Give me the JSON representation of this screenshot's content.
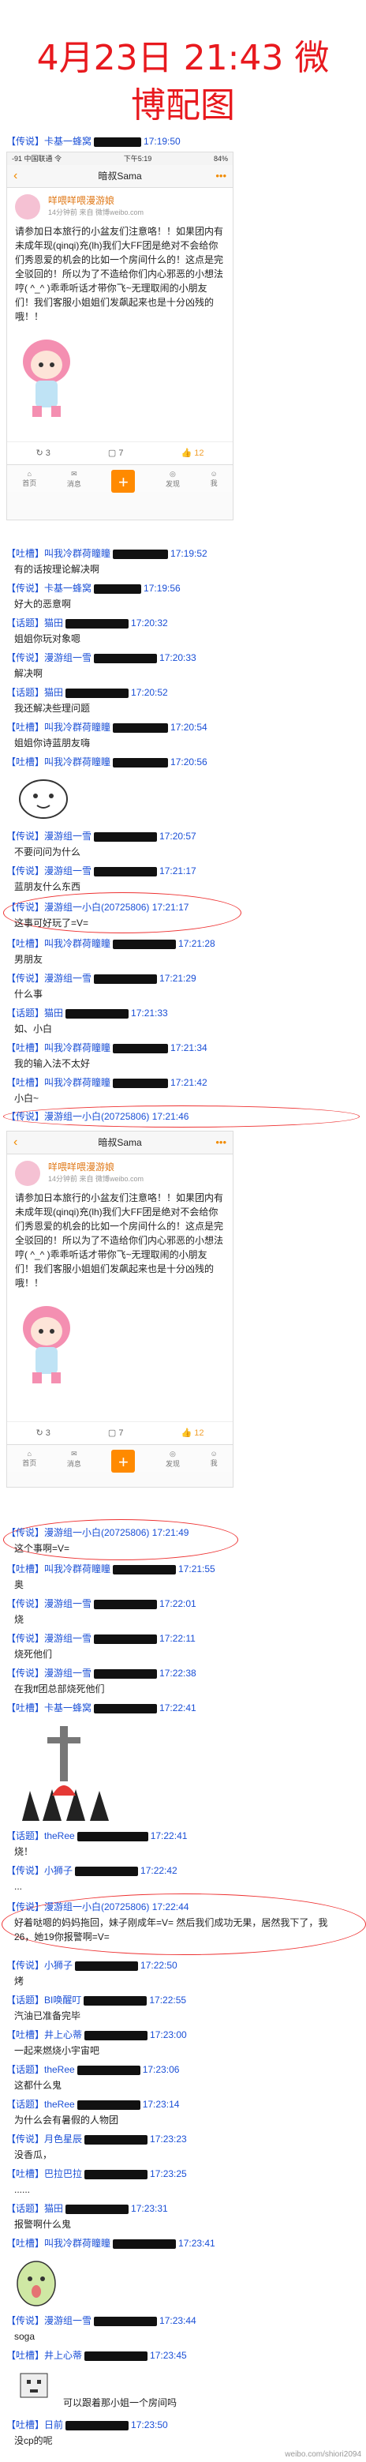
{
  "header": {
    "title_line1": "4月23日 21:43 微",
    "title_line2": "博配图"
  },
  "phone1": {
    "status_left": "-91 中国联通 令",
    "status_time": "下午5:19",
    "status_right": "84%",
    "nav_title": "暗叔Sama",
    "post_user": "咩喂咩喂漫游娘",
    "post_meta": "14分钟前 来自 微博weibo.com",
    "post_body": "请参加日本旅行的小盆友们注意咯！！如果团内有未成年现(qinqi)充(lh)我们大FF团是绝对不会给你们秀恩爱的机会的比如一个房间什么的！这点是完全驳回的！所以为了不造给你们内心邪恶的小想法哼( ^_^ )乖乖听话才带你飞~无理取闹的小朋友们！我们客服小姐姐们发飙起来也是十分凶残的哦！！",
    "repost": "3",
    "comments": "7",
    "likes": "12",
    "tabs": [
      "首页",
      "消息",
      "",
      "发现",
      "我"
    ]
  },
  "phone2": {
    "nav_title": "暗叔Sama",
    "post_user": "咩喂咩喂漫游娘",
    "post_meta": "14分钟前 来自 微博weibo.com",
    "post_body": "请参加日本旅行的小盆友们注意咯！！如果团内有未成年现(qinqi)充(lh)我们大FF团是绝对不会给你们秀恩爱的机会的比如一个房间什么的！这点是完全驳回的！所以为了不造给你们内心邪恶的小想法哼( ^_^ )乖乖听话才带你飞~无理取闹的小朋友们！我们客服小姐姐们发飙起来也是十分凶残的哦！！",
    "repost": "3",
    "comments": "7",
    "likes": "12",
    "tabs": [
      "首页",
      "消息",
      "",
      "发现",
      "我"
    ]
  },
  "chat": [
    {
      "nick": "【传说】卡基一蜂窝",
      "time": "17:19:50",
      "text": ""
    },
    {
      "nick": "【吐槽】叫我冷群荷瞳瞳",
      "time": "17:19:52",
      "text": "有的话按理论解决啊"
    },
    {
      "nick": "【传说】卡基一蜂窝",
      "time": "17:19:56",
      "text": "好大的恶意啊"
    },
    {
      "nick": "【话题】猫田",
      "time": "17:20:32",
      "text": "姐姐你玩对象嗯"
    },
    {
      "nick": "【传说】漫游组一雪",
      "time": "17:20:33",
      "text": "解决啊"
    },
    {
      "nick": "【话题】猫田",
      "time": "17:20:52",
      "text": "我还解决些理问题"
    },
    {
      "nick": "【吐槽】叫我冷群荷瞳瞳",
      "time": "17:20:54",
      "text": "姐姐你诗蓝朋友嗨"
    },
    {
      "nick": "【吐槽】叫我冷群荷瞳瞳",
      "time": "17:20:56",
      "text": ""
    },
    {
      "nick": "【传说】漫游组一雪",
      "time": "17:20:57",
      "text": "不要问问为什么"
    },
    {
      "nick": "【传说】漫游组一雪",
      "time": "17:21:17",
      "text": "蓝朋友什么东西"
    },
    {
      "nick": "【传说】漫游组一小白(20725806)",
      "time": "17:21:17",
      "text": "这事可好玩了=V="
    },
    {
      "nick": "【吐槽】叫我冷群荷瞳瞳",
      "time": "17:21:28",
      "text": "男朋友"
    },
    {
      "nick": "【传说】漫游组一雪",
      "time": "17:21:29",
      "text": "什么事"
    },
    {
      "nick": "【话题】猫田",
      "time": "17:21:33",
      "text": "如、小白"
    },
    {
      "nick": "【吐槽】叫我冷群荷瞳瞳",
      "time": "17:21:34",
      "text": "我的输入法不太好"
    },
    {
      "nick": "【吐槽】叫我冷群荷瞳瞳",
      "time": "17:21:42",
      "text": "小白~"
    },
    {
      "nick": "【传说】漫游组一小白(20725806)",
      "time": "17:21:46",
      "text": ""
    },
    {
      "nick": "【传说】漫游组一小白(20725806)",
      "time": "17:21:49",
      "text": "这个事啊=V="
    },
    {
      "nick": "【吐槽】叫我冷群荷瞳瞳",
      "time": "17:21:55",
      "text": "奥"
    },
    {
      "nick": "【传说】漫游组一雪",
      "time": "17:22:01",
      "text": "烧"
    },
    {
      "nick": "【传说】漫游组一雪",
      "time": "17:22:11",
      "text": "烧死他们"
    },
    {
      "nick": "【传说】漫游组一雪",
      "time": "17:22:38",
      "text": "在我ff团总部烧死他们"
    },
    {
      "nick": "【吐槽】卡基一蜂窝",
      "time": "17:22:41",
      "text": ""
    },
    {
      "nick": "【话题】theRee",
      "time": "17:22:41",
      "text": "烧！"
    },
    {
      "nick": "【传说】小狮子",
      "time": "17:22:42",
      "text": "..."
    },
    {
      "nick": "【传说】漫游组一小白(20725806)",
      "time": "17:22:44",
      "text": "好着哒嗯的妈妈拖回，妹子刚成年=V=  然后我们成功无果，居然我下了，我26，她19你报警啊=V="
    },
    {
      "nick": "【传说】小狮子",
      "time": "17:22:50",
      "text": "烤"
    },
    {
      "nick": "【话题】BI唤醒叮",
      "time": "17:22:55",
      "text": "汽油已准备完毕"
    },
    {
      "nick": "【吐槽】井上心蒂",
      "time": "17:23:00",
      "text": "一起来燃烧小宇宙吧"
    },
    {
      "nick": "【话题】theRee",
      "time": "17:23:06",
      "text": "这都什么鬼"
    },
    {
      "nick": "【话题】theRee",
      "time": "17:23:14",
      "text": "为什么会有暑假的人物团"
    },
    {
      "nick": "【传说】月色星辰",
      "time": "17:23:23",
      "text": "没香瓜，"
    },
    {
      "nick": "【吐槽】巴拉巴拉",
      "time": "17:23:25",
      "text": "......"
    },
    {
      "nick": "【话题】猫田",
      "time": "17:23:31",
      "text": "报警啊什么鬼"
    },
    {
      "nick": "【吐槽】叫我冷群荷瞳瞳",
      "time": "17:23:41",
      "text": ""
    },
    {
      "nick": "【传说】漫游组一雪",
      "time": "17:23:44",
      "text": "soga"
    },
    {
      "nick": "【吐槽】井上心蒂",
      "time": "17:23:45",
      "text": ""
    },
    {
      "nick": "【吐槽】日前",
      "time": "17:23:50",
      "text": "没cp的呢"
    }
  ],
  "inline_text": {
    "after_sticker": "可以跟着那小姐一个房间吗"
  },
  "watermark": "weibo.com/shiori2094"
}
